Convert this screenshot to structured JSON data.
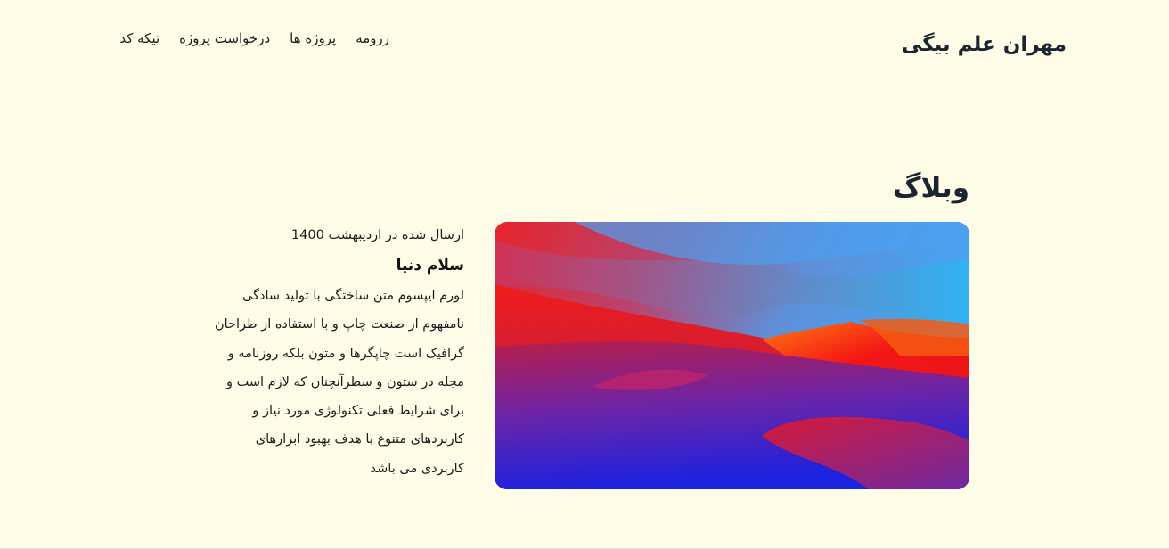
{
  "header": {
    "site_title": "مهران علم بیگی",
    "nav": [
      {
        "label": "رزومه"
      },
      {
        "label": "پروژه ها"
      },
      {
        "label": "درخواست پروژه"
      },
      {
        "label": "تیکه کد"
      }
    ]
  },
  "blog": {
    "section_title": "وبلاگ",
    "post": {
      "date": "ارسال شده در اردیبهشت 1400",
      "title": "سلام دنیا",
      "body_lines": [
        "لورم ایپسوم متن ساختگی با تولید سادگی",
        "نامفهوم از صنعت چاپ و با استفاده از طراحان",
        "گرافیک است چاپگرها و متون بلکه روزنامه و",
        "مجله در ستون و سطرآنچنان که لازم است و",
        "برای شرایط فعلی تکنولوژی مورد نیاز و",
        "کاربردهای متنوع با هدف بهبود ابزارهای",
        "کاربردی می باشد"
      ]
    }
  },
  "colors": {
    "background": "#fffde7",
    "heading": "#1a2530"
  },
  "icons": {
    "post_image": "desert-dunes-wallpaper"
  }
}
